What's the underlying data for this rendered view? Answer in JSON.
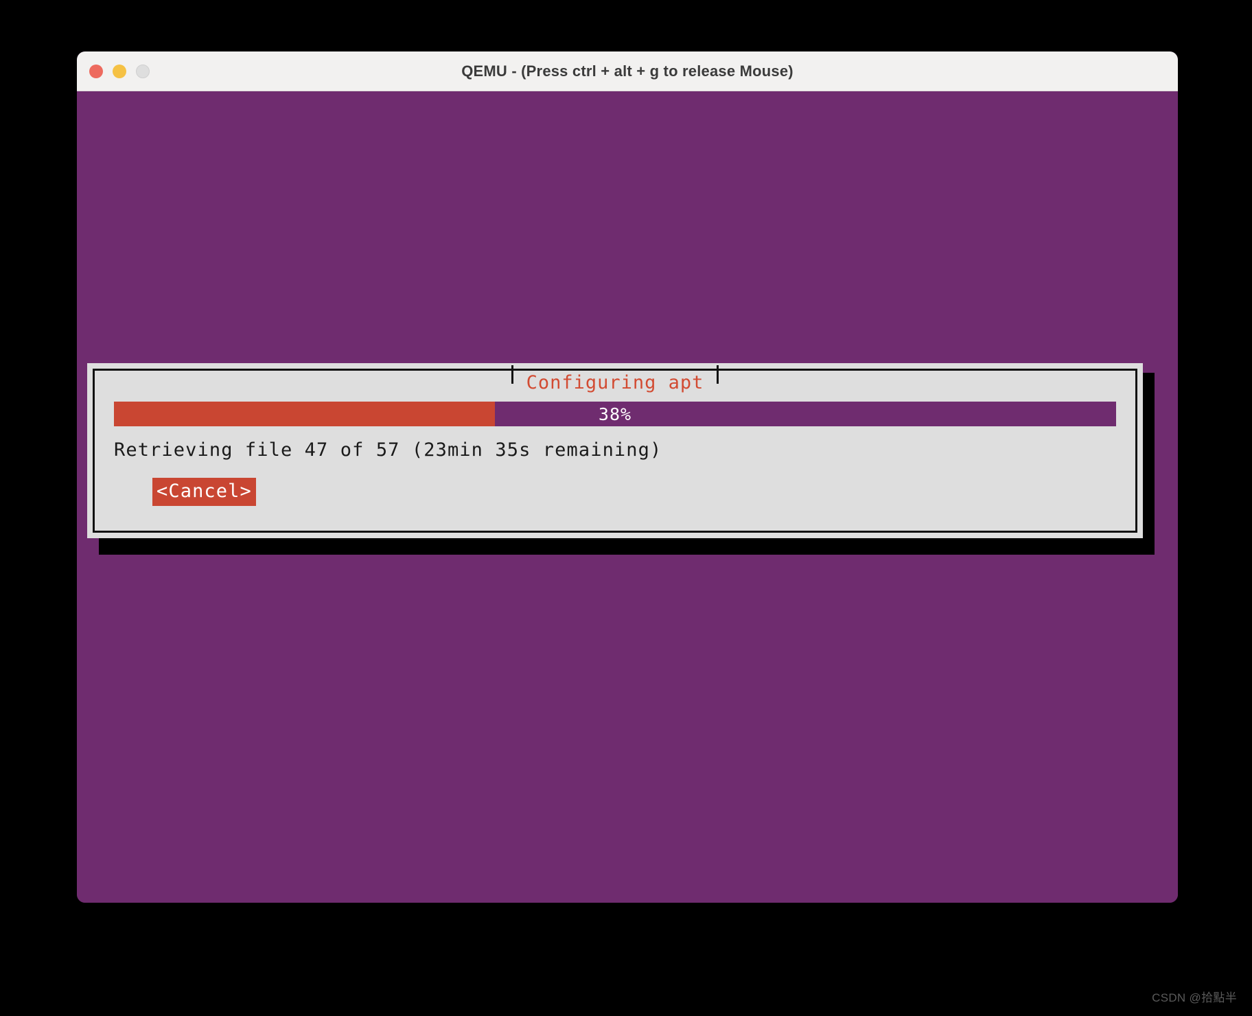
{
  "window": {
    "title": "QEMU - (Press ctrl + alt + g to release Mouse)",
    "controls": {
      "close_label": "",
      "minimize_label": "",
      "zoom_label": ""
    }
  },
  "vm": {
    "background_color": "#6F2C6F"
  },
  "dialog": {
    "title": "Configuring apt",
    "title_color": "#D24B32",
    "background_color": "#DEDEDE",
    "border_color": "#111111",
    "progress": {
      "percent_label": "38%",
      "percent_value": 38,
      "fill_color": "#C94632",
      "track_color": "#6F2C6F",
      "label_color": "#FFFFFF"
    },
    "status_text": "Retrieving file 47 of 57 (23min 35s remaining)",
    "buttons": [
      {
        "label": "<Cancel>",
        "background_color": "#C94632",
        "text_color": "#FFFFFF",
        "focused": true
      }
    ]
  },
  "watermark": {
    "text": "CSDN @拾點半"
  }
}
